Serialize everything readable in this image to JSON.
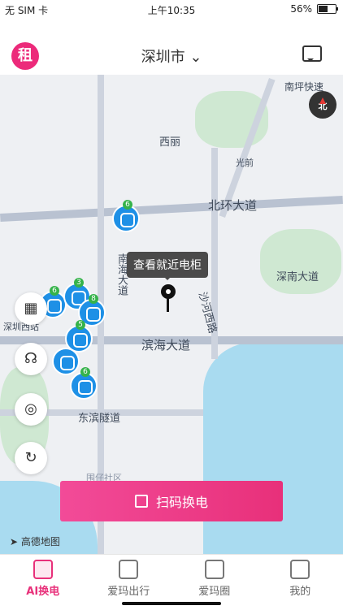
{
  "status_bar": {
    "carrier": "无 SIM 卡",
    "time": "上午10:35",
    "battery": "56%",
    "battery_level": 0.56
  },
  "header": {
    "rent_badge": "租",
    "city": "深圳市",
    "city_caret": "⌄"
  },
  "map": {
    "compass": "北",
    "labels": {
      "xili": "西丽",
      "guangqian": "光前",
      "beihuan": "北环大道",
      "shennan": "深南大道",
      "shahe": "沙河西路",
      "binhai": "滨海大道",
      "dongbin": "东滨隧道",
      "nanhai": "南海大道",
      "guanwei": "围仔社区",
      "guanlan": "南坪快速",
      "jiyi": "深圳西站"
    },
    "tooltip": "查看就近电柜",
    "markers": [
      {
        "count": "6"
      },
      {
        "count": "6"
      },
      {
        "count": "3"
      },
      {
        "count": "8"
      },
      {
        "count": "5"
      },
      {
        "count": "6"
      }
    ],
    "provider": "高德地图"
  },
  "controls": {
    "layout_icon": "四格",
    "service_icon": "客服",
    "locate_icon": "定位",
    "refresh_icon": "刷新"
  },
  "scan_button": {
    "label": "扫码换电"
  },
  "tabs": [
    {
      "label": "AI换电",
      "active": true
    },
    {
      "label": "爱玛出行",
      "active": false
    },
    {
      "label": "爱玛圈",
      "active": false
    },
    {
      "label": "我的",
      "active": false
    }
  ],
  "colors": {
    "brand": "#e8307a",
    "marker": "#1e90e6"
  }
}
